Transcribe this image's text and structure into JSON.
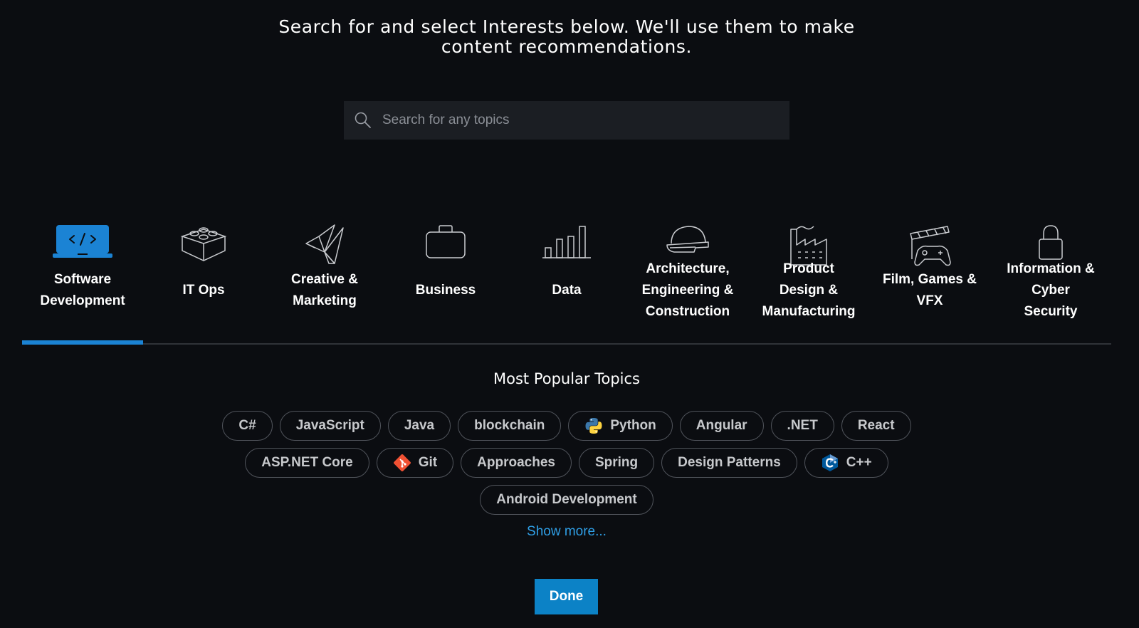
{
  "intro": {
    "line1": "Search for and select Interests below. We'll use them to make",
    "line2": "content recommendations."
  },
  "search": {
    "placeholder": "Search for any topics",
    "icon": "search-icon"
  },
  "categories": [
    {
      "label_lines": [
        "Software",
        "Development"
      ],
      "icon": "laptop-code-icon",
      "active": true
    },
    {
      "label_lines": [
        "IT Ops"
      ],
      "icon": "server-brick-icon",
      "active": false
    },
    {
      "label_lines": [
        "Creative &",
        "Marketing"
      ],
      "icon": "origami-bird-icon",
      "active": false
    },
    {
      "label_lines": [
        "Business"
      ],
      "icon": "briefcase-icon",
      "active": false
    },
    {
      "label_lines": [
        "Data"
      ],
      "icon": "bar-chart-icon",
      "active": false
    },
    {
      "label_lines": [
        "Architecture,",
        "Engineering &",
        "Construction"
      ],
      "icon": "hard-hat-icon",
      "active": false
    },
    {
      "label_lines": [
        "Product",
        "Design &",
        "Manufacturing"
      ],
      "icon": "factory-icon",
      "active": false
    },
    {
      "label_lines": [
        "Film, Games &",
        "VFX"
      ],
      "icon": "clapper-gamepad-icon",
      "active": false
    },
    {
      "label_lines": [
        "Information &",
        "Cyber",
        "Security"
      ],
      "icon": "lock-icon",
      "active": false
    }
  ],
  "popular": {
    "title": "Most Popular Topics",
    "rows": [
      [
        {
          "label": "C#"
        },
        {
          "label": "JavaScript"
        },
        {
          "label": "Java"
        },
        {
          "label": "blockchain"
        },
        {
          "label": "Python",
          "icon": "python-logo-icon"
        },
        {
          "label": "Angular"
        },
        {
          "label": ".NET"
        },
        {
          "label": "React"
        }
      ],
      [
        {
          "label": "ASP.NET Core"
        },
        {
          "label": "Git",
          "icon": "git-logo-icon"
        },
        {
          "label": "Approaches"
        },
        {
          "label": "Spring"
        },
        {
          "label": "Design Patterns"
        },
        {
          "label": "C++",
          "icon": "cpp-logo-icon"
        }
      ],
      [
        {
          "label": "Android Development"
        }
      ]
    ],
    "show_more": "Show more..."
  },
  "done_button": "Done",
  "colors": {
    "background": "#0b0d11",
    "accent": "#1b83d4",
    "link": "#2f9fe6",
    "button": "#0c82c6"
  }
}
